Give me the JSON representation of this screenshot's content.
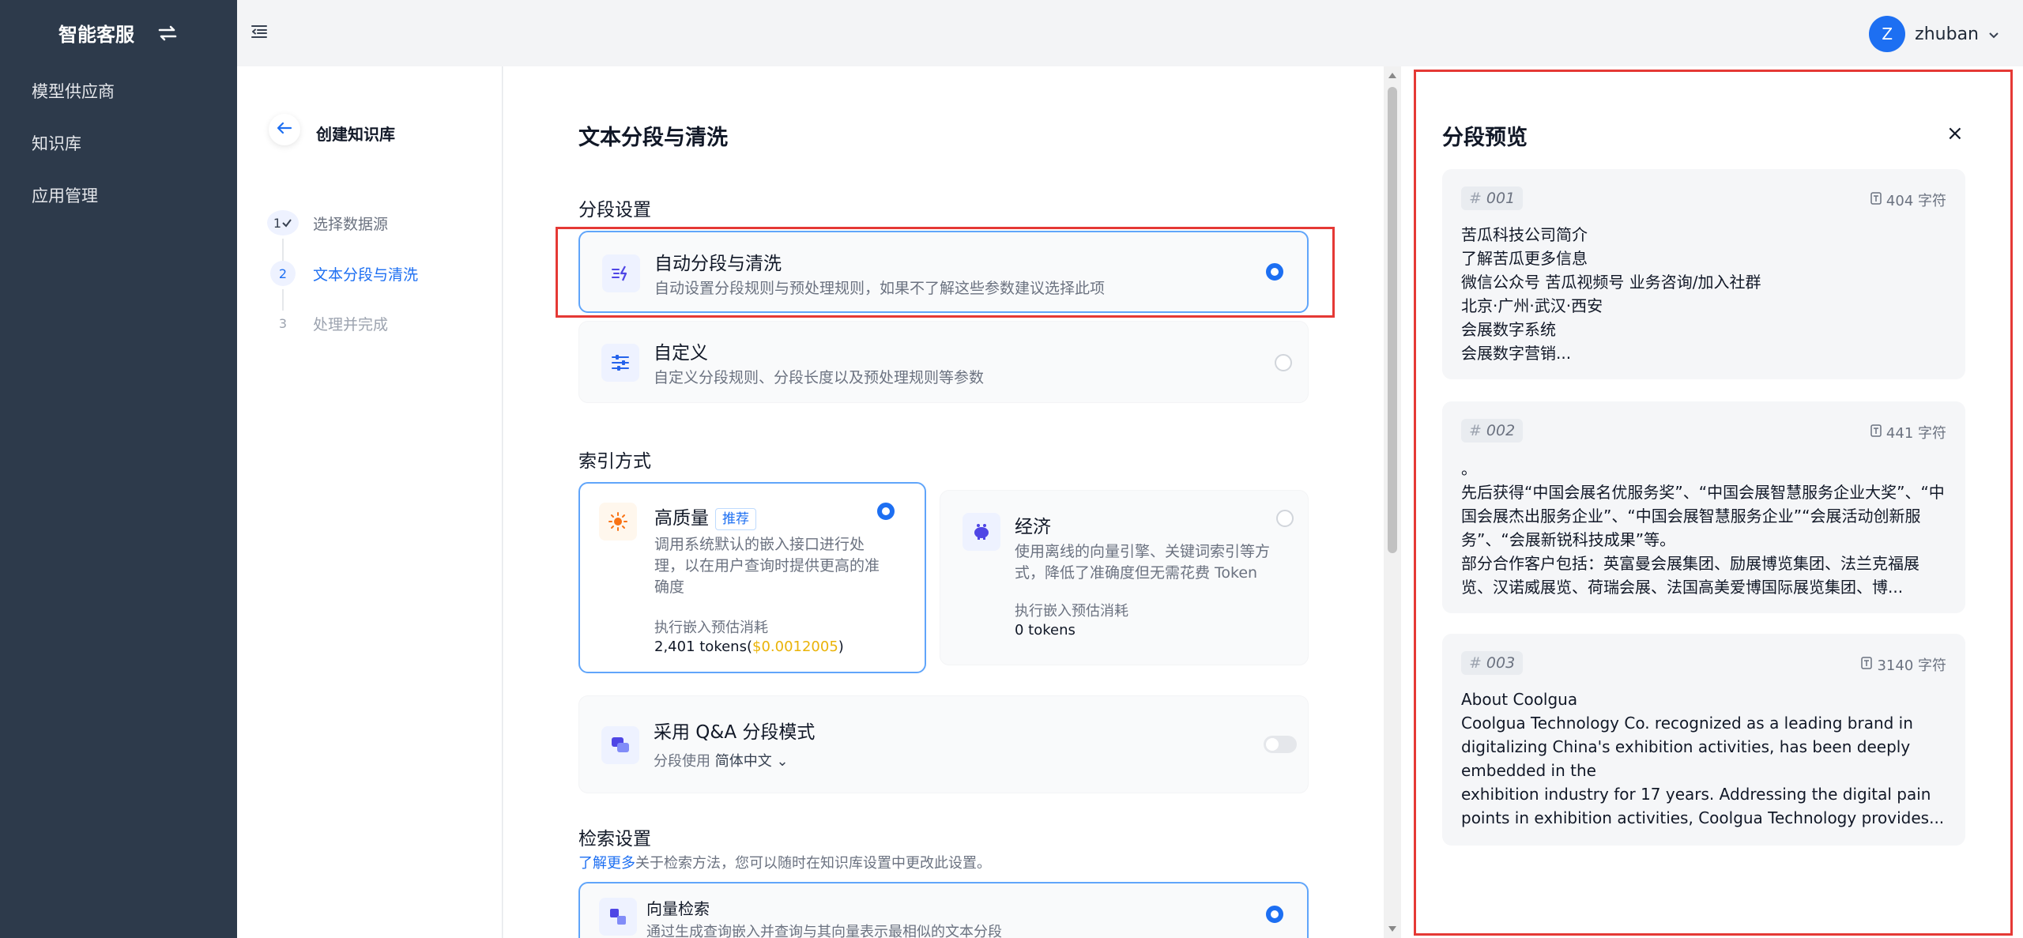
{
  "sidebar": {
    "brand": "智能客服",
    "items": [
      {
        "label": "模型供应商"
      },
      {
        "label": "知识库"
      },
      {
        "label": "应用管理"
      }
    ]
  },
  "topbar": {
    "user_initial": "Z",
    "username": "zhuban"
  },
  "steps_panel": {
    "title": "创建知识库",
    "steps": [
      {
        "num": "1",
        "label": "选择数据源",
        "state": "done"
      },
      {
        "num": "2",
        "label": "文本分段与清洗",
        "state": "active"
      },
      {
        "num": "3",
        "label": "处理并完成",
        "state": "pending"
      }
    ]
  },
  "main": {
    "title": "文本分段与清洗",
    "segment_section": "分段设置",
    "auto": {
      "title": "自动分段与清洗",
      "desc": "自动设置分段规则与预处理规则，如果不了解这些参数建议选择此项",
      "selected": true
    },
    "custom": {
      "title": "自定义",
      "desc": "自定义分段规则、分段长度以及预处理规则等参数",
      "selected": false
    },
    "index_section": "索引方式",
    "high_quality": {
      "title": "高质量",
      "tag": "推荐",
      "desc_lines": [
        "调用系统默认的嵌入接口进行处",
        "理，以在用户查询时提供更高的准",
        "确度"
      ],
      "cost_label": "执行嵌入预估消耗",
      "tokens": "2,401 tokens(",
      "cost": "$0.0012005",
      "tokens_end": ")",
      "selected": true
    },
    "economy": {
      "title": "经济",
      "desc_lines": [
        "使用离线的向量引擎、关键词索引等方",
        "式，降低了准确度但无需花费 Token"
      ],
      "cost_label": "执行嵌入预估消耗",
      "tokens": "0 tokens",
      "selected": false
    },
    "qa": {
      "title": "采用 Q&A 分段模式",
      "sub": "分段使用",
      "lang": "简体中文",
      "enabled": false
    },
    "retrieval_section": "检索设置",
    "retrieval_link": "了解更多",
    "retrieval_hint": "关于检索方法，您可以随时在知识库设置中更改此设置。",
    "vector": {
      "title": "向量检索",
      "desc": "通过生成查询嵌入并查询与其向量表示最相似的文本分段",
      "selected": true
    }
  },
  "preview": {
    "title": "分段预览",
    "close": "×",
    "chunks": [
      {
        "id": "001",
        "count": "404 字符",
        "text": "苦瓜科技公司简介\n了解苦瓜更多信息\n微信公众号 苦瓜视频号 业务咨询/加入社群\n北京·广州·武汉·西安\n会展数字系统\n会展数字营销..."
      },
      {
        "id": "002",
        "count": "441 字符",
        "text": "。\n先后获得“中国会展名优服务奖”、“中国会展智慧服务企业大奖”、“中国会展杰出服务企业”、“中国会展智慧服务企业”“会展活动创新服务”、“会展新锐科技成果”等。\n部分合作客户包括：英富曼会展集团、励展博览集团、法兰克福展览、汉诺威展览、荷瑞会展、法国高美爱博国际展览集团、博..."
      },
      {
        "id": "003",
        "count": "3140 字符",
        "text": "About Coolgua\nCoolgua Technology Co. recognized as a leading brand in digitalizing China's exhibition activities, has been deeply embedded in the\nexhibition industry for 17 years. Addressing the digital pain points in exhibition activities, Coolgua Technology provides..."
      }
    ]
  },
  "colors": {
    "sidebar_bg": "#2d3a4b",
    "accent": "#1d6ff2",
    "highlight_border": "#e53935",
    "cost": "#eab308"
  },
  "icons": [
    "switch-icon",
    "menu-fold-icon",
    "chevron-down-icon",
    "arrow-left-icon",
    "check-icon",
    "sparkle-split-icon",
    "sliders-icon",
    "sun-icon",
    "piggy-bank-icon",
    "chat-bubbles-icon",
    "translate-icon",
    "close-icon",
    "document-icon"
  ]
}
